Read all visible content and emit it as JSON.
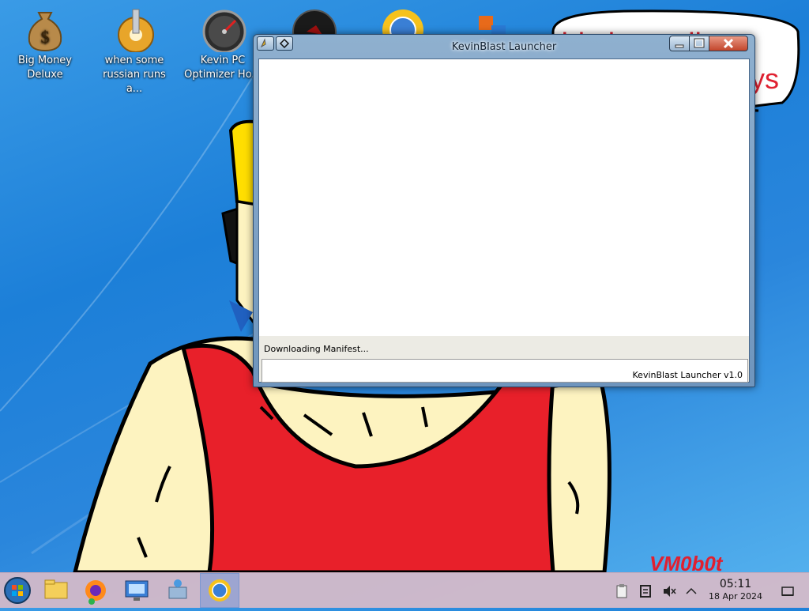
{
  "desktop": {
    "icons": [
      {
        "label": "Big Money\nDeluxe",
        "icon": "money-bag-icon"
      },
      {
        "label": "when some\nrussian runs a...",
        "icon": "gear-icon"
      },
      {
        "label": "Kevin PC\nOptimizer Ho...",
        "icon": "speedometer-icon"
      },
      {
        "label": "",
        "icon": "dark-orb-icon"
      },
      {
        "label": "",
        "icon": "sun-globe-icon"
      },
      {
        "label": "",
        "icon": "office-icon"
      }
    ],
    "wallpaper": {
      "speech_text_1": "this is totally",
      "speech_text_2": "ys",
      "signature": "VM0b0t"
    }
  },
  "window": {
    "title": "KevinBlast Launcher",
    "status": "Downloading Manifest...",
    "version": "KevinBlast Launcher v1.0",
    "progress": 0
  },
  "taskbar": {
    "apps": [
      "start-orb-icon",
      "file-explorer-icon",
      "firefox-icon",
      "remote-desktop-icon",
      "network-icon",
      "kevinblast-launcher-icon"
    ],
    "clock_time": "05:11",
    "clock_date": "18 Apr 2024"
  },
  "colors": {
    "wallpaper_blue": "#1c7fd8",
    "shirt_red": "#e8202a",
    "skin": "#fdf3c0",
    "hair_yellow": "#ffde00",
    "taskbar": "#d6bac8"
  }
}
